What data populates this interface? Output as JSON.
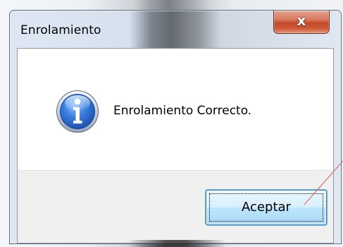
{
  "window": {
    "title": "Enrolamiento",
    "close_glyph": "x"
  },
  "message": {
    "icon": "information-icon",
    "text": "Enrolamiento Correcto."
  },
  "buttons": {
    "ok_label": "Aceptar"
  },
  "colors": {
    "close_button": "#c24a2a",
    "ok_button_border": "#3c7fb1",
    "icon_blue": "#1f5fbf",
    "annotation_line": "#e06a6a"
  }
}
